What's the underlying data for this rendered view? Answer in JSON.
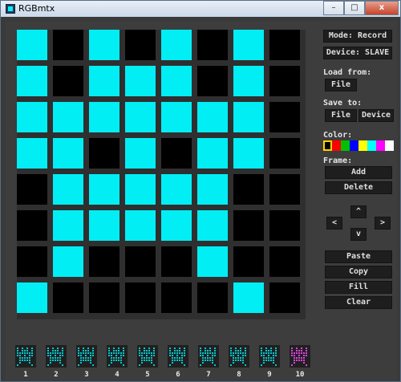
{
  "window": {
    "title": "RGBmtx",
    "buttons": {
      "minimize": "–",
      "maximize": "□",
      "close": "x"
    }
  },
  "grid": {
    "rows": 8,
    "cols": 8,
    "on_color": "#00eef4",
    "off_color": "#000000",
    "cells": [
      [
        1,
        0,
        1,
        0,
        1,
        0,
        1,
        0
      ],
      [
        1,
        0,
        1,
        1,
        1,
        0,
        1,
        0
      ],
      [
        1,
        1,
        1,
        1,
        1,
        1,
        1,
        0
      ],
      [
        1,
        1,
        0,
        1,
        0,
        1,
        1,
        0
      ],
      [
        0,
        1,
        1,
        1,
        1,
        1,
        0,
        0
      ],
      [
        0,
        1,
        1,
        1,
        1,
        1,
        0,
        0
      ],
      [
        0,
        1,
        0,
        0,
        0,
        1,
        0,
        0
      ],
      [
        1,
        0,
        0,
        0,
        0,
        0,
        1,
        0
      ]
    ]
  },
  "panel": {
    "mode_button": "Mode: Record",
    "device_button": "Device: SLAVE",
    "load_label": "Load from:",
    "load_file_button": "File",
    "save_label": "Save to:",
    "save_file_button": "File",
    "save_device_button": "Device",
    "color_label": "Color:",
    "colors": [
      "#000000",
      "#ff0000",
      "#00c000",
      "#0000ff",
      "#ffff00",
      "#00ffff",
      "#ff00ff",
      "#ffffff"
    ],
    "selected_color_index": 0,
    "frame_label": "Frame:",
    "add_button": "Add",
    "delete_button": "Delete",
    "nav": {
      "left": "<",
      "up": "^",
      "right": ">",
      "down": "v"
    },
    "paste_button": "Paste",
    "copy_button": "Copy",
    "fill_button": "Fill",
    "clear_button": "Clear"
  },
  "frames": [
    {
      "number": "1",
      "color": "#00c8d0"
    },
    {
      "number": "2",
      "color": "#00c8d0"
    },
    {
      "number": "3",
      "color": "#00c8d0"
    },
    {
      "number": "4",
      "color": "#00c8d0"
    },
    {
      "number": "5",
      "color": "#00c8d0"
    },
    {
      "number": "6",
      "color": "#00c8d0"
    },
    {
      "number": "7",
      "color": "#00c8d0"
    },
    {
      "number": "8",
      "color": "#00c8d0"
    },
    {
      "number": "9",
      "color": "#00c8d0"
    },
    {
      "number": "10",
      "color": "#e040e0"
    }
  ]
}
